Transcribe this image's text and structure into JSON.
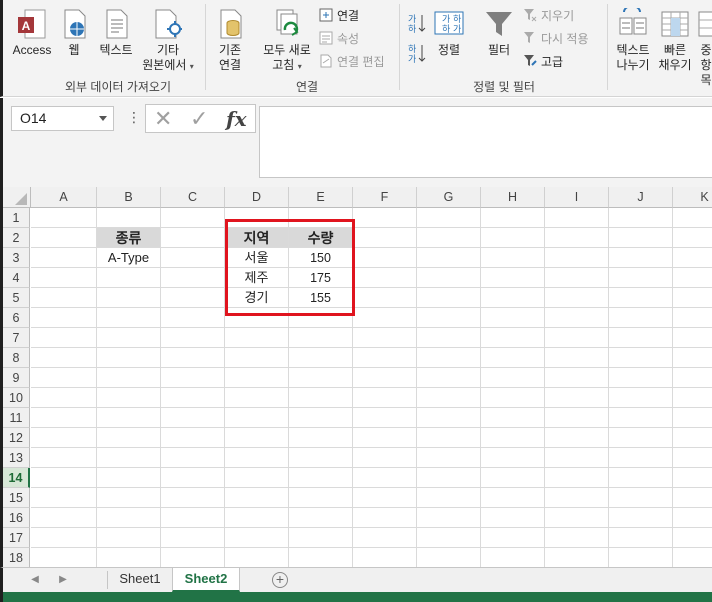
{
  "ribbon": {
    "get_external": {
      "access": "Access",
      "web": "웹",
      "text": "텍스트",
      "other_line1": "기타",
      "other_line2": "원본에서",
      "group_label": "외부 데이터 가져오기"
    },
    "connections": {
      "existing_line1": "기존",
      "existing_line2": "연결",
      "refresh_line1": "모두 새로",
      "refresh_line2": "고침",
      "connections": "연결",
      "properties": "속성",
      "edit_links": "연결 편집",
      "group_label": "연결"
    },
    "sort_filter": {
      "sort": "정렬",
      "filter": "필터",
      "clear": "지우기",
      "reapply": "다시 적용",
      "advanced": "고급",
      "group_label": "정렬 및 필터"
    },
    "data_tools": {
      "text_to_columns_line1": "텍스트",
      "text_to_columns_line2": "나누기",
      "flash_fill_line1": "빠른",
      "flash_fill_line2": "채우기",
      "remove_dup_line1": "중",
      "remove_dup_line2": "항목"
    }
  },
  "formula_bar": {
    "name_box": "O14",
    "dots": "⋮",
    "cancel": "✕",
    "enter": "✓",
    "fx": "fx",
    "value": ""
  },
  "grid": {
    "columns": [
      "A",
      "B",
      "C",
      "D",
      "E",
      "F",
      "G",
      "H",
      "I",
      "J",
      "K"
    ],
    "rows": [
      "1",
      "2",
      "3",
      "4",
      "5",
      "6",
      "7",
      "8",
      "9",
      "10",
      "11",
      "12",
      "13",
      "14",
      "15",
      "16",
      "17",
      "18"
    ],
    "active_row": "14",
    "cells": {
      "B2": "종류",
      "B3": "A-Type",
      "D2": "지역",
      "E2": "수량",
      "D3": "서울",
      "E3": "150",
      "D4": "제주",
      "E4": "175",
      "D5": "경기",
      "E5": "155"
    },
    "highlight_color": "#e0141e"
  },
  "sheets": {
    "tabs": [
      "Sheet1",
      "Sheet2"
    ],
    "active": "Sheet2",
    "add_symbol": "+",
    "prev": "◀",
    "next": "▶"
  },
  "colors": {
    "accent": "#217346",
    "ribbon_bg": "#f3f3f3"
  }
}
